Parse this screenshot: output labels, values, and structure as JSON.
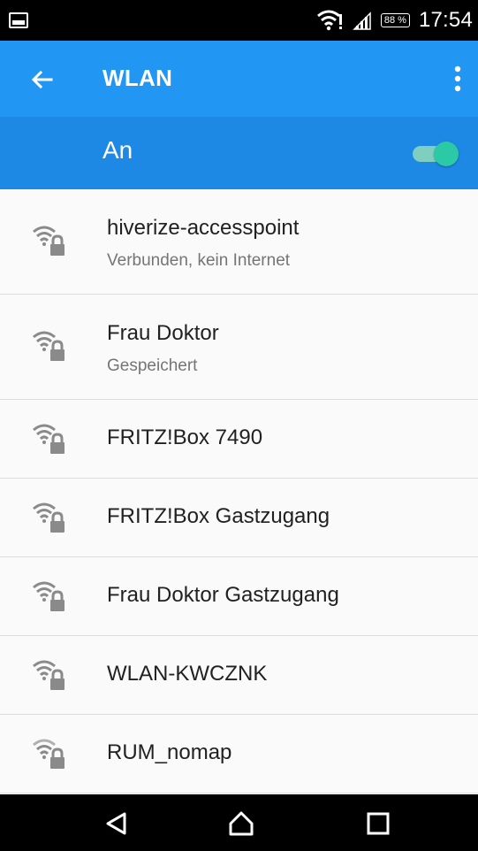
{
  "status_bar": {
    "time": "17:54",
    "battery": "88 %",
    "icons": [
      "image-notification-icon",
      "wifi-alert-icon",
      "cell-signal-icon",
      "battery-icon"
    ]
  },
  "app_bar": {
    "title": "WLAN",
    "back_icon": "arrow-back-icon",
    "menu_icon": "more-vert-icon",
    "color": "#2196f3"
  },
  "wlan_toggle": {
    "label": "An",
    "state": "on",
    "accent": "#2bc9a5"
  },
  "networks": [
    {
      "ssid": "hiverize-accesspoint",
      "status": "Verbunden, kein Internet"
    },
    {
      "ssid": "Frau Doktor",
      "status": "Gespeichert"
    },
    {
      "ssid": "FRITZ!Box 7490"
    },
    {
      "ssid": "FRITZ!Box Gastzugang"
    },
    {
      "ssid": "Frau Doktor Gastzugang"
    },
    {
      "ssid": "WLAN-KWCZNK"
    },
    {
      "ssid": "RUM_nomap"
    }
  ],
  "nav_bar": {
    "icons": [
      "back-triangle-icon",
      "home-icon",
      "recents-icon"
    ]
  }
}
